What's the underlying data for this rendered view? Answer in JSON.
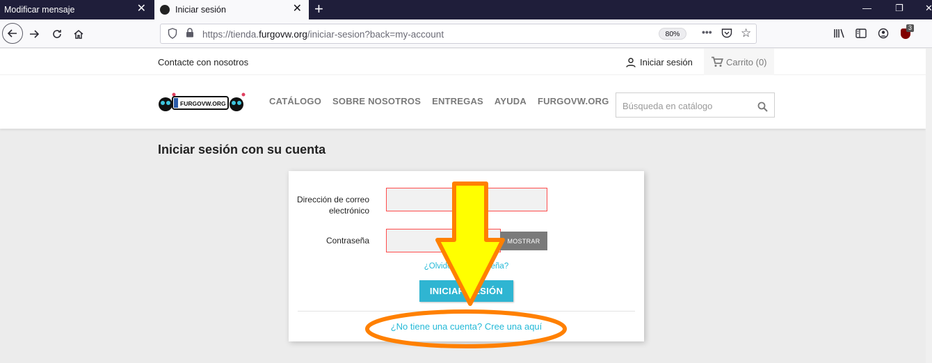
{
  "browser": {
    "tabs": [
      {
        "title": "Modificar mensaje",
        "active": false
      },
      {
        "title": "Iniciar sesión",
        "active": true
      }
    ],
    "url_prefix": "https://tienda.",
    "url_host": "furgovw.org",
    "url_path": "/iniciar-sesion?back=my-account",
    "zoom": "80%",
    "extension_badge": "3"
  },
  "topnav": {
    "contact": "Contacte con nosotros",
    "signin": "Iniciar sesión",
    "cart": "Carrito (0)"
  },
  "header": {
    "logo_text": "FURGOVW.ORG",
    "menu": [
      "CATÁLOGO",
      "SOBRE NOSOTROS",
      "ENTREGAS",
      "AYUDA",
      "FURGOVW.ORG"
    ],
    "search_placeholder": "Búsqueda en catálogo"
  },
  "main": {
    "title": "Iniciar sesión con su cuenta",
    "form": {
      "email_label": "Dirección de correo electrónico",
      "password_label": "Contraseña",
      "email_value": "",
      "password_value": "",
      "show_button": "MOSTRAR",
      "forgot_link": "¿Olvidó su contraseña?",
      "submit": "INICIAR SESIÓN",
      "create_account": "¿No tiene una cuenta? Cree una aquí"
    }
  },
  "annotation": {
    "arrow_color": "#ffff00",
    "outline_color": "#ff8000"
  },
  "colors": {
    "accent": "#2fb5d2",
    "error_border": "#ff4c4c",
    "tabbar": "#1f1e3a"
  }
}
